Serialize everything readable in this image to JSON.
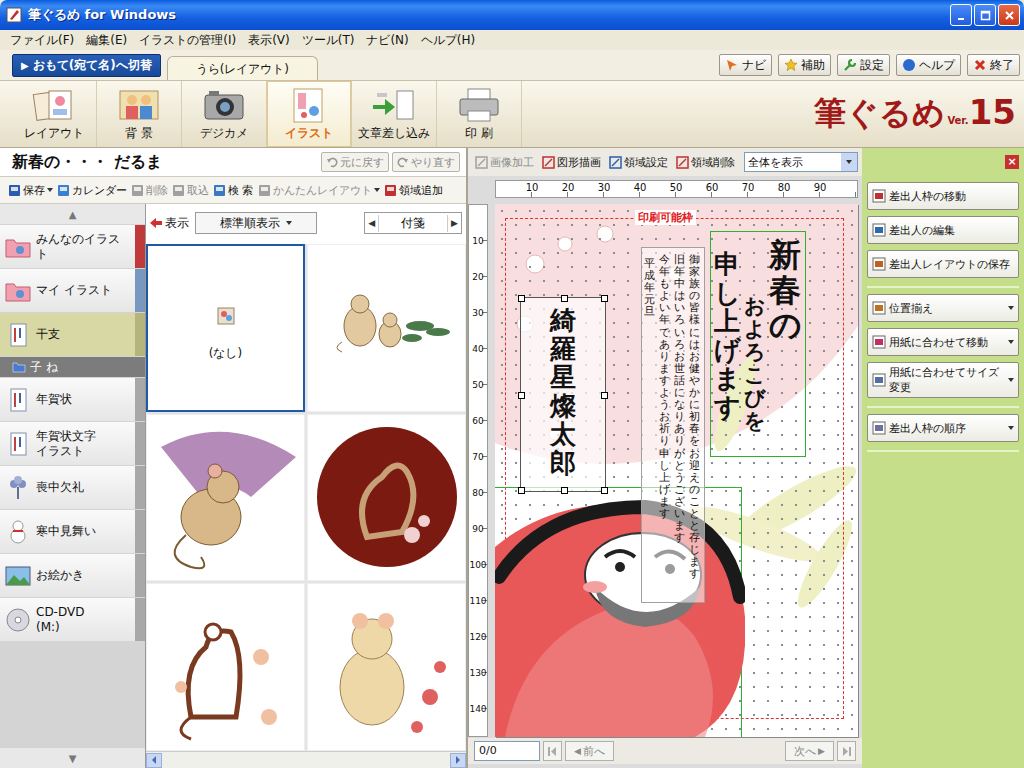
{
  "window": {
    "title": "筆ぐるめ for Windows"
  },
  "menu": [
    "ファイル(F)",
    "編集(E)",
    "イラストの管理(I)",
    "表示(V)",
    "ツール(T)",
    "ナビ(N)",
    "ヘルプ(H)"
  ],
  "side_switch": {
    "arrow": "▶",
    "label": "おもて(宛て名)へ切替"
  },
  "mode_tabs": [
    {
      "label": "うら(レイアウト)",
      "selected": true
    }
  ],
  "help_buttons": [
    {
      "label": "ナビ",
      "kind": "navi"
    },
    {
      "label": "補助",
      "kind": "star"
    },
    {
      "label": "設定",
      "kind": "wrench"
    },
    {
      "label": "ヘルプ",
      "kind": "help"
    },
    {
      "label": "終了",
      "kind": "exit"
    }
  ],
  "tools": [
    {
      "label": "レイアウト",
      "kind": "layout",
      "selected": false
    },
    {
      "label": "背 景",
      "kind": "background",
      "selected": false
    },
    {
      "label": "デジカメ",
      "kind": "camera",
      "selected": false
    },
    {
      "label": "イラスト",
      "kind": "illust",
      "selected": true
    },
    {
      "label": "文章差し込み",
      "kind": "text",
      "selected": false
    },
    {
      "label": "印 刷",
      "kind": "print",
      "selected": false
    }
  ],
  "logo": {
    "name": "筆ぐるめ",
    "prefix": "Ver.",
    "version": "15"
  },
  "layout": {
    "title": "新春の・・・ だるま",
    "undo": {
      "label": "元に戻す",
      "disabled": true
    },
    "redo": {
      "label": "やり直す",
      "disabled": true
    }
  },
  "panel_toolbar": [
    {
      "label": "保存",
      "kind": "save",
      "dropdown": true,
      "disabled": false
    },
    {
      "label": "カレンダー",
      "kind": "calendar",
      "dropdown": false,
      "disabled": false
    },
    {
      "label": "削除",
      "kind": "delete",
      "dropdown": false,
      "disabled": true
    },
    {
      "label": "取込",
      "kind": "import",
      "dropdown": false,
      "disabled": true
    },
    {
      "label": "検 索",
      "kind": "search",
      "dropdown": false,
      "disabled": false
    },
    {
      "label": "かんたんレイアウト",
      "kind": "easy",
      "dropdown": true,
      "disabled": true
    },
    {
      "label": "領域追加",
      "kind": "area",
      "dropdown": false,
      "disabled": false
    }
  ],
  "categories": {
    "up": "▲",
    "down": "▼",
    "items": [
      {
        "lines": [
          "みんなのイラスト"
        ],
        "kind": "category",
        "icon": "folder",
        "selected": false,
        "color": "#c0393b"
      },
      {
        "lines": [
          "マイ イラスト"
        ],
        "kind": "category",
        "icon": "folder",
        "selected": false,
        "color": "#7a97c0"
      },
      {
        "lines": [
          "干支"
        ],
        "kind": "category",
        "icon": "card",
        "selected": true,
        "color": "#b4b47c"
      },
      {
        "lines": [
          "子 ね"
        ],
        "kind": "folder",
        "icon": "folder-small",
        "selected": true,
        "color": "#7c7c7c"
      },
      {
        "lines": [
          "年賀状"
        ],
        "kind": "category",
        "icon": "card",
        "selected": false,
        "color": "#a8a8a8"
      },
      {
        "lines": [
          "年賀状文字",
          "イラスト"
        ],
        "kind": "category",
        "icon": "card",
        "selected": false,
        "color": "#a8a8a8"
      },
      {
        "lines": [
          "喪中欠礼"
        ],
        "kind": "category",
        "icon": "flower",
        "selected": false,
        "color": "#a8a8a8"
      },
      {
        "lines": [
          "寒中見舞い"
        ],
        "kind": "category",
        "icon": "snowman",
        "selected": false,
        "color": "#a8a8a8"
      },
      {
        "lines": [
          "お絵かき"
        ],
        "kind": "category",
        "icon": "picture",
        "selected": false,
        "color": "#a8a8a8"
      },
      {
        "lines": [
          "CD-DVD",
          "(M:)"
        ],
        "kind": "category",
        "icon": "disc",
        "selected": false,
        "color": "#a8a8a8"
      }
    ]
  },
  "grid_bar": {
    "view": "表示",
    "sort": "標準順表示",
    "tag": "付箋",
    "prev": "◀",
    "next": "▶"
  },
  "illustrations": [
    {
      "kind": "none",
      "label": "(なし)",
      "selected": true
    },
    {
      "kind": "mice-pine",
      "selected": false
    },
    {
      "kind": "mouse-fan",
      "selected": false
    },
    {
      "kind": "mouse-circle",
      "selected": false
    },
    {
      "kind": "mouse-brown",
      "selected": false
    },
    {
      "kind": "mouse-beige",
      "selected": false
    }
  ],
  "canvas_toolbar": {
    "tools": [
      {
        "label": "画像加工",
        "kind": "image",
        "disabled": true
      },
      {
        "label": "図形描画",
        "kind": "shape",
        "disabled": false
      },
      {
        "label": "領域設定",
        "kind": "area-set",
        "disabled": false
      },
      {
        "label": "領域削除",
        "kind": "area-delete",
        "disabled": false
      }
    ],
    "zoom": "全体を表示"
  },
  "ruler": {
    "horizontal": [
      "10",
      "20",
      "30",
      "40",
      "50",
      "60",
      "70",
      "80",
      "90"
    ],
    "vertical": [
      "10",
      "20",
      "30",
      "40",
      "50",
      "60",
      "70",
      "80",
      "90",
      "100",
      "110",
      "120",
      "130",
      "140"
    ]
  },
  "postcard": {
    "frame_label": "印刷可能枠",
    "greeting": [
      "新春の",
      "およろこびを",
      "申し上げます"
    ],
    "message": [
      "御家族の皆様にはお健やかに初春をお迎えのことと存じます",
      "旧年中はいろいろお世話になりありがとうございます",
      "今年もよい年でありますようお祈り申し上げます",
      "平成　年　元旦"
    ],
    "sender": "綺羅星燦太郎"
  },
  "pager": {
    "page": "0/0",
    "prev": {
      "arrow": "◀",
      "label": "前へ",
      "disabled": true
    },
    "next": {
      "label": "次へ",
      "arrow": "▶",
      "disabled": true
    }
  },
  "right_panel": {
    "close": "×",
    "groups": [
      [
        {
          "label": "差出人枠の移動",
          "kind": "move",
          "dropdown": false
        },
        {
          "label": "差出人の編集",
          "kind": "edit",
          "dropdown": false
        },
        {
          "label": "差出人レイアウトの保存",
          "kind": "save",
          "dropdown": false
        }
      ],
      [
        {
          "label": "位置揃え",
          "kind": "align",
          "dropdown": true
        },
        {
          "label": "用紙に合わせて移動",
          "kind": "fit",
          "dropdown": true
        },
        {
          "label": "用紙に合わせてサイズ変更",
          "kind": "size",
          "dropdown": true
        }
      ],
      [
        {
          "label": "差出人枠の順序",
          "kind": "order",
          "dropdown": true
        }
      ]
    ]
  }
}
